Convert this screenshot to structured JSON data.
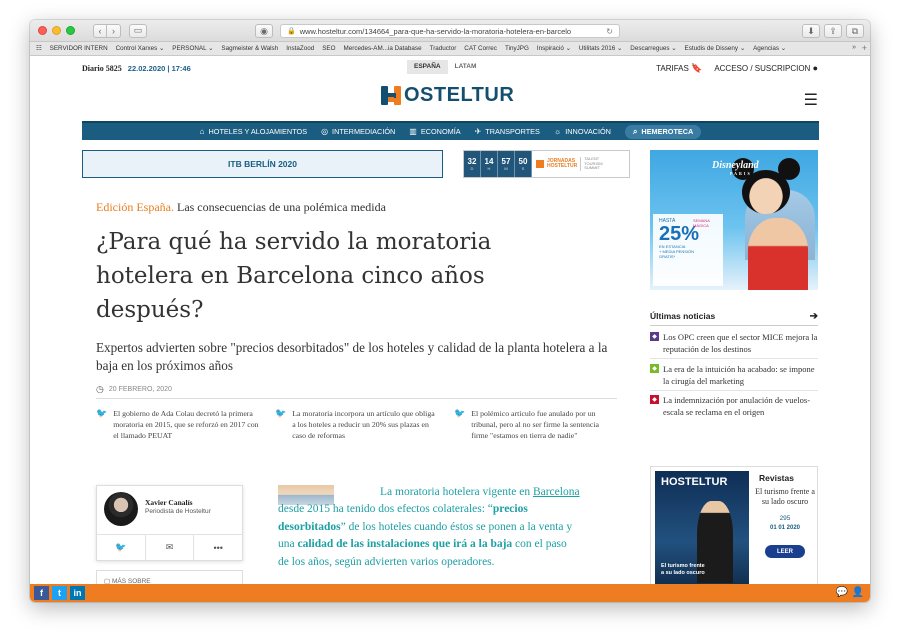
{
  "browser": {
    "url": "www.hosteltur.com/134664_para-que-ha-servido-la-moratoria-hotelera-en-barcelo",
    "bookmarks": [
      "SERVIDOR INTERN",
      "Control Xarxes ⌄",
      "PERSONAL ⌄",
      "Sagmeister & Walsh",
      "InstaZood",
      "SEO",
      "Mercedes-AM...ia Database",
      "Traductor",
      "CAT Correc",
      "TinyJPG",
      "Inspiració ⌄",
      "Utilitats 2016 ⌄",
      "Descarregues ⌄",
      "Estudis de Disseny ⌄",
      "Agencias ⌄"
    ]
  },
  "topbar": {
    "diario": "Diario 5825",
    "date": "22.02.2020 | 17:46",
    "editions": [
      "ESPAÑA",
      "LATAM"
    ],
    "tarifas": "TARIFAS",
    "acceso": "ACCESO / SUSCRIPCION"
  },
  "logo": {
    "word": "OSTELTUR"
  },
  "nav": {
    "items": [
      "HOTELES Y ALOJAMIENTOS",
      "INTERMEDIACIÓN",
      "ECONOMÍA",
      "TRANSPORTES",
      "INNOVACIÓN"
    ],
    "hemeroteca": "HEMEROTECA"
  },
  "banner": {
    "itb": "ITB BERLÍN 2020"
  },
  "countdown": {
    "values": [
      "32",
      "14",
      "57",
      "50"
    ],
    "units": [
      "D",
      "H",
      "M",
      "S"
    ],
    "jornadas_line1": "JORNADAS",
    "jornadas_line2": "HOSTELTUR",
    "tagline_1": "TALENT",
    "tagline_2": "TOURISM",
    "tagline_3": "SUMMIT"
  },
  "article": {
    "kicker_edition": "Edición España.",
    "kicker_text": " Las consecuencias de una polémica medida",
    "headline": "¿Para qué ha servido la moratoria hotelera en Barcelona cinco años después?",
    "subhead": "Expertos advierten sobre \"precios desorbitados\" de los hoteles y calidad de la planta hotelera a la baja en los próximos años",
    "date": "20 FEBRERO, 2020",
    "tweets": [
      "El gobierno de Ada Colau decretó la primera moratoria en 2015, que se reforzó en 2017 con el llamado PEUAT",
      "La moratoria incorpora un artículo que obliga a los hoteles a reducir un 20% sus plazas en caso de reformas",
      "El polémico artículo fue anulado por un tribunal, pero al no ser firme la sentencia firme \"estamos en tierra de nadie\""
    ],
    "author_name": "Xavier Canalís",
    "author_role": "Periodista de Hosteltur",
    "mas_sobre": "MÁS SOBRE",
    "body_1": "La moratoria hotelera vigente en ",
    "body_link": "Barcelona",
    "body_2": " desde 2015 ha tenido dos efectos colaterales: “",
    "body_b1": "precios desorbitados",
    "body_3": "” de los hoteles cuando éstos se ponen a la venta y una ",
    "body_b2": "calidad de las instalaciones que irá a la baja",
    "body_4": " con el paso de los años, según advierten varios operadores."
  },
  "ad": {
    "brand": "Disneyland",
    "brand_sub": "PARIS",
    "hasta": "HASTA",
    "pct": "25%",
    "detail_1": "EN ESTANCIA",
    "detail_2": "+ MEDIA PENSIÓN",
    "detail_3": "GRATIS*",
    "semana": "SEMANA MÁGICA"
  },
  "sidebar": {
    "ultimas": "Últimas noticias",
    "news": [
      {
        "text": "Los OPC creen que el sector MICE mejora la reputación de los destinos",
        "color": "#5b3a8c"
      },
      {
        "text": "La era de la intuición ha acabado: se impone la cirugía del marketing",
        "color": "#7ab929"
      },
      {
        "text": "La indemnización por anulación de vuelos-escala se reclama en el origen",
        "color": "#c8102e"
      }
    ]
  },
  "revistas": {
    "title": "Revistas",
    "subtitle": "El turismo frente a su lado oscuro",
    "number": "295",
    "date": "01 01 2020",
    "leer": "LEER",
    "cover_brand": "HOSTELTUR",
    "cover_text": "El turismo frente a su lado oscuro"
  },
  "colors": {
    "brand_blue": "#1b5d81",
    "brand_orange": "#ee7d21",
    "teal_text": "#1ea0a4"
  }
}
